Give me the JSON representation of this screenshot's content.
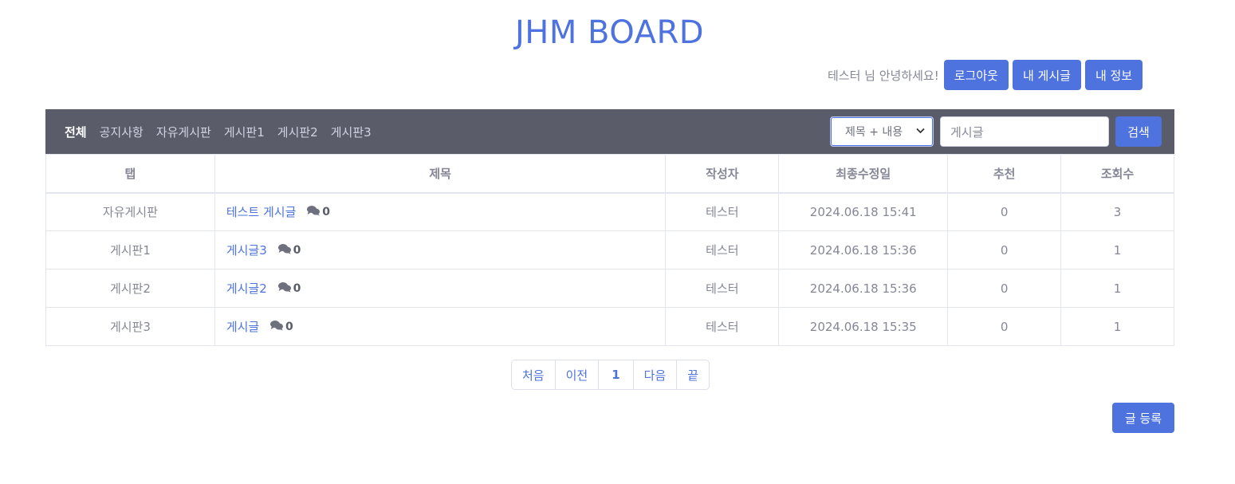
{
  "header": {
    "site_title": "JHM BOARD",
    "greeting": "테스터 님 안녕하세요!",
    "logout_label": "로그아웃",
    "my_posts_label": "내 게시글",
    "my_info_label": "내 정보"
  },
  "nav": {
    "tabs": [
      {
        "label": "전체",
        "active": true
      },
      {
        "label": "공지사항",
        "active": false
      },
      {
        "label": "자유게시판",
        "active": false
      },
      {
        "label": "게시판1",
        "active": false
      },
      {
        "label": "게시판2",
        "active": false
      },
      {
        "label": "게시판3",
        "active": false
      }
    ],
    "search_type": "제목 + 내용",
    "search_value": "게시글",
    "search_button": "검색"
  },
  "table": {
    "columns": [
      "탭",
      "제목",
      "작성자",
      "최종수정일",
      "추천",
      "조회수"
    ],
    "rows": [
      {
        "tab": "자유게시판",
        "title": "테스트 게시글",
        "comments": "0",
        "author": "테스터",
        "modified": "2024.06.18 15:41",
        "likes": "0",
        "views": "3"
      },
      {
        "tab": "게시판1",
        "title": "게시글3",
        "comments": "0",
        "author": "테스터",
        "modified": "2024.06.18 15:36",
        "likes": "0",
        "views": "1"
      },
      {
        "tab": "게시판2",
        "title": "게시글2",
        "comments": "0",
        "author": "테스터",
        "modified": "2024.06.18 15:36",
        "likes": "0",
        "views": "1"
      },
      {
        "tab": "게시판3",
        "title": "게시글",
        "comments": "0",
        "author": "테스터",
        "modified": "2024.06.18 15:35",
        "likes": "0",
        "views": "1"
      }
    ]
  },
  "pagination": {
    "first": "처음",
    "prev": "이전",
    "current": "1",
    "next": "다음",
    "last": "끝"
  },
  "write_button": "글 등록",
  "colors": {
    "primary": "#4e73df",
    "navbar": "#5a5c69",
    "text": "#858796"
  }
}
